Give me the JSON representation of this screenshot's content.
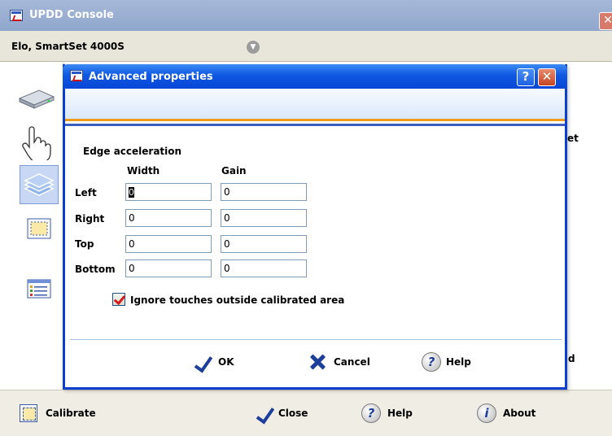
{
  "main_window": {
    "title": "UPDD Console",
    "close_symbol": "✕",
    "device_name": "Elo, SmartSet 4000S",
    "peek_text_1": "et",
    "peek_text_2": "d",
    "sidebar_icons": [
      "drive-icon",
      "hand-pointer-icon",
      "layers-icon",
      "calibrate-icon",
      "list-icon"
    ],
    "bottom_buttons": {
      "calibrate": "Calibrate",
      "close": "Close",
      "help": "Help",
      "about": "About"
    }
  },
  "dialog": {
    "title": "Advanced properties",
    "help_symbol": "?",
    "close_symbol": "✕",
    "group_title": "Edge acceleration",
    "columns": {
      "width": "Width",
      "gain": "Gain"
    },
    "rows": [
      {
        "label": "Left",
        "width": "0",
        "gain": "0"
      },
      {
        "label": "Right",
        "width": "0",
        "gain": "0"
      },
      {
        "label": "Top",
        "width": "0",
        "gain": "0"
      },
      {
        "label": "Bottom",
        "width": "0",
        "gain": "0"
      }
    ],
    "ignore_outside": {
      "label": "Ignore touches outside calibrated area",
      "checked": true
    },
    "buttons": {
      "ok": "OK",
      "cancel": "Cancel",
      "help": "Help"
    },
    "help_glyph": "?"
  },
  "about_glyph": "i",
  "colors": {
    "dialog_border": "#0a3fd0",
    "header_accent": "#ef9c1a",
    "main_titlebar": "#8fa6cc",
    "checkmark": "#d71a1a"
  }
}
